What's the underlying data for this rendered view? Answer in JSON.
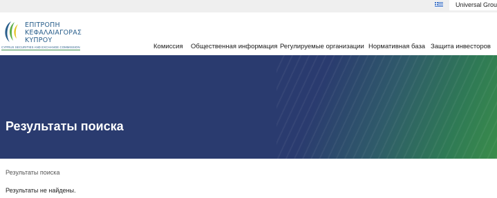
{
  "topbar": {
    "language_flag": "greek-flag-icon",
    "group_label": "Universal Group"
  },
  "logo": {
    "line1": "ΕΠΙΤΡΟΠΗ",
    "line2": "ΚΕΦΑΛΑΙΑΓΟΡΑΣ",
    "line3": "ΚΥΠΡΟΥ",
    "tagline": "CYPRUS SECURITIES AND EXCHANGE COMMISSION"
  },
  "nav": {
    "items": [
      {
        "label": "Комиссия"
      },
      {
        "label": "Общественная информация"
      },
      {
        "label": "Регулируемые организации"
      },
      {
        "label": "Нормативная база"
      },
      {
        "label": "Защита инвесторов"
      }
    ]
  },
  "hero": {
    "title": "Результаты поиска"
  },
  "breadcrumb": {
    "current": "Результаты поиска"
  },
  "results": {
    "message": "Результаты не найдены."
  },
  "colors": {
    "hero_blue": "#2a3b6f",
    "hero_green": "#3a8c4a",
    "logo_blue": "#2a5f8c",
    "topbar_bg": "#efefef"
  }
}
